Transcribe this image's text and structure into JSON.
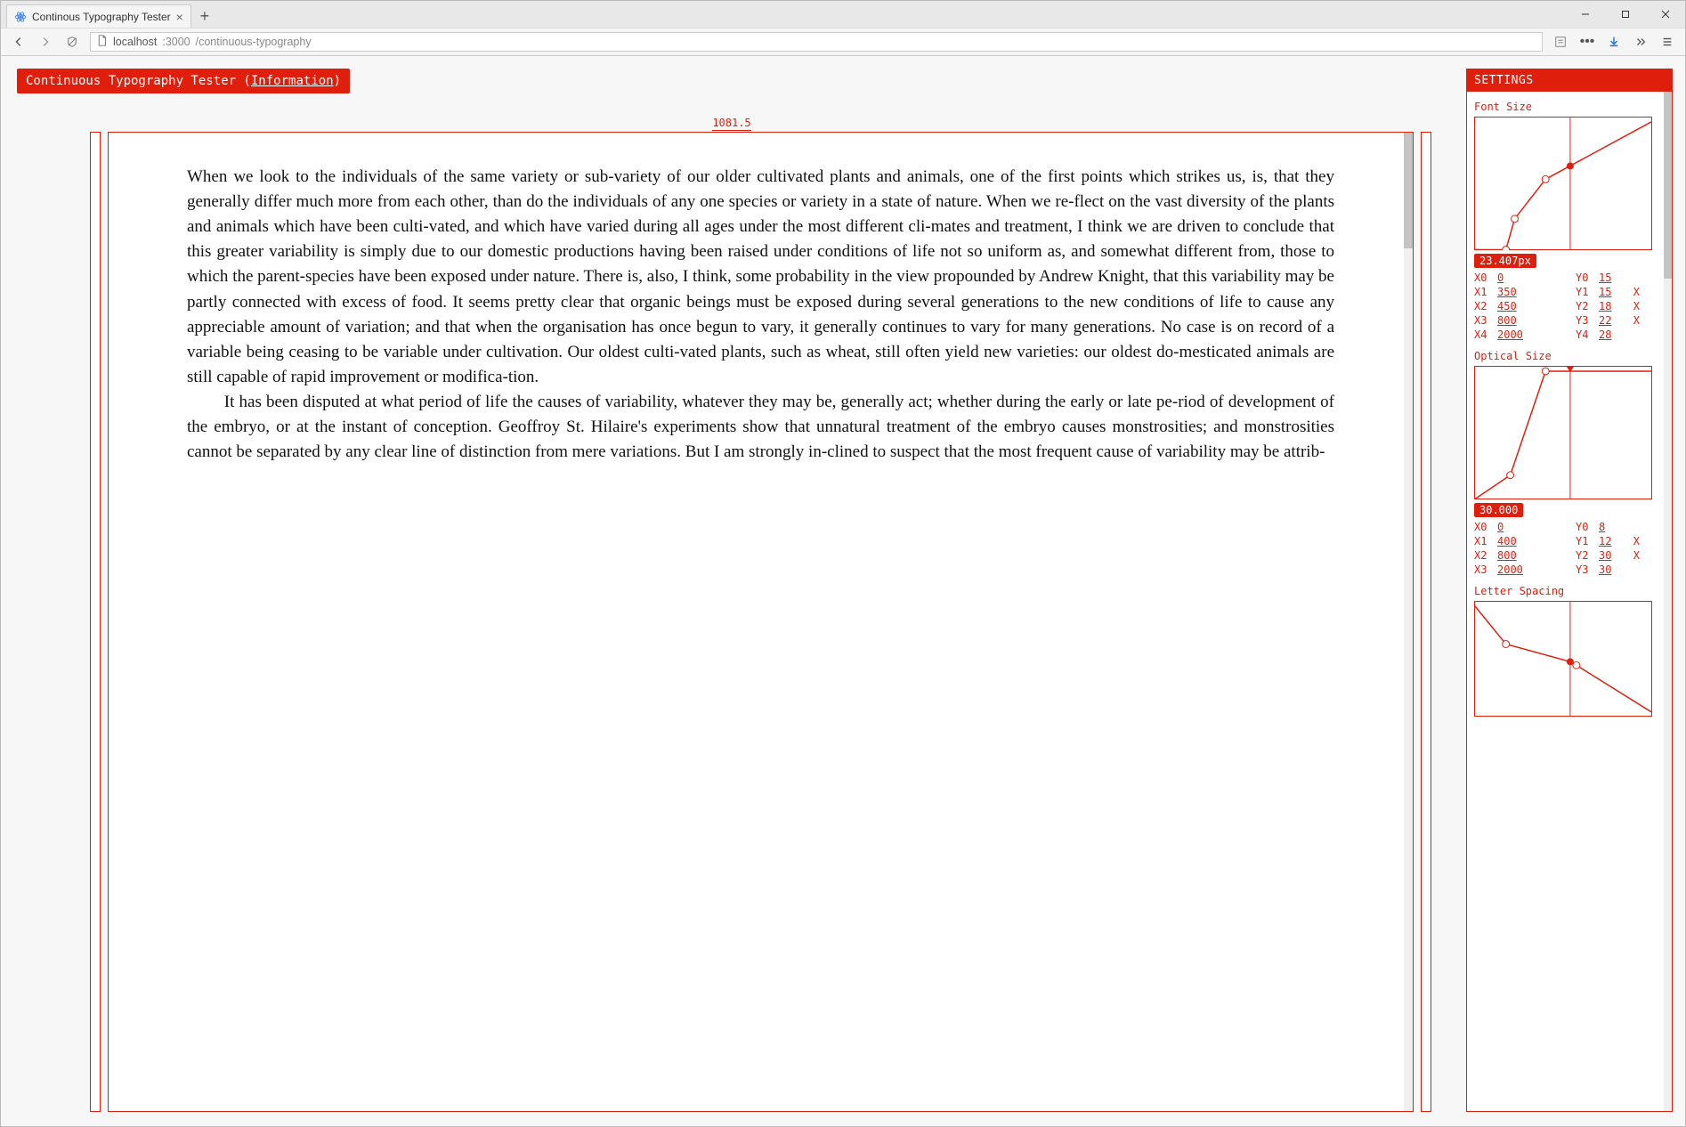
{
  "browser": {
    "tab_title": "Continous Typography Tester",
    "url_host": "localhost",
    "url_port": ":3000",
    "url_path": "/continuous-typography"
  },
  "app": {
    "title_prefix": "Continuous Typography Tester (",
    "info_link": "Information",
    "title_suffix": ")",
    "width_readout": "1081.5"
  },
  "paragraphs": {
    "p1": "When we look to the individuals of the same variety or sub-variety of our older cultivated plants and animals, one of the first points which strikes us, is, that they generally differ much more from each other, than do the individuals of any one species or variety in a state of nature. When we re‐flect on the vast diversity of the plants and animals which have been culti‐vated, and which have varied during all ages under the most different cli‐mates and treatment, I think we are driven to conclude that this greater variability is simply due to our domestic productions having been raised under conditions of life not so uniform as, and somewhat different from, those to which the parent-species have been exposed under nature. There is, also, I think, some probability in the view propounded by Andrew Knight, that this variability may be partly connected with excess of food. It seems pretty clear that organic beings must be exposed during several generations to the new conditions of life to cause any appreciable amount of variation; and that when the organisation has once begun to vary, it generally continues to vary for many generations. No case is on record of a variable being ceasing to be variable under cultivation. Our oldest culti‐vated plants, such as wheat, still often yield new varieties: our oldest do‐mesticated animals are still capable of rapid improvement or modifica‐tion.",
    "p2": "It has been disputed at what period of life the causes of variability, whatever they may be, generally act; whether during the early or late pe‐riod of development of the embryo, or at the instant of conception. Geoffroy St. Hilaire's experiments show that unnatural treatment of the embryo causes monstrosities; and monstrosities cannot be separated by any clear line of distinction from mere variations. But I am strongly in‐clined to suspect that the most frequent cause of variability may be attrib‐"
  },
  "settings": {
    "header": "SETTINGS",
    "font_size": {
      "title": "Font Size",
      "current": "23.407px",
      "rows": [
        {
          "xl": "X0",
          "xv": "0",
          "yl": "Y0",
          "yv": "15",
          "del": ""
        },
        {
          "xl": "X1",
          "xv": "350",
          "yl": "Y1",
          "yv": "15",
          "del": "X"
        },
        {
          "xl": "X2",
          "xv": "450",
          "yl": "Y2",
          "yv": "18",
          "del": "X"
        },
        {
          "xl": "X3",
          "xv": "800",
          "yl": "Y3",
          "yv": "22",
          "del": "X"
        },
        {
          "xl": "X4",
          "xv": "2000",
          "yl": "Y4",
          "yv": "28",
          "del": ""
        }
      ]
    },
    "optical_size": {
      "title": "Optical Size",
      "current": "30.000",
      "rows": [
        {
          "xl": "X0",
          "xv": "0",
          "yl": "Y0",
          "yv": "8",
          "del": ""
        },
        {
          "xl": "X1",
          "xv": "400",
          "yl": "Y1",
          "yv": "12",
          "del": "X"
        },
        {
          "xl": "X2",
          "xv": "800",
          "yl": "Y2",
          "yv": "30",
          "del": "X"
        },
        {
          "xl": "X3",
          "xv": "2000",
          "yl": "Y3",
          "yv": "30",
          "del": ""
        }
      ]
    },
    "letter_spacing": {
      "title": "Letter Spacing"
    }
  },
  "chart_data": [
    {
      "type": "line",
      "title": "Font Size",
      "xlabel": "",
      "ylabel": "",
      "xlim": [
        0,
        2000
      ],
      "ylim": [
        15,
        28
      ],
      "x": [
        0,
        350,
        450,
        800,
        2000
      ],
      "y": [
        15,
        15,
        18,
        22,
        28
      ],
      "current_x": 1081.5,
      "current_y": 23.407
    },
    {
      "type": "line",
      "title": "Optical Size",
      "xlabel": "",
      "ylabel": "",
      "xlim": [
        0,
        2000
      ],
      "ylim": [
        8,
        30
      ],
      "x": [
        0,
        400,
        800,
        2000
      ],
      "y": [
        8,
        12,
        30,
        30
      ],
      "current_x": 1081.5,
      "current_y": 30.0
    },
    {
      "type": "line",
      "title": "Letter Spacing",
      "xlabel": "",
      "ylabel": "",
      "xlim": [
        0,
        2000
      ],
      "ylim": [
        0,
        1
      ],
      "x": [
        0,
        350,
        1081.5,
        1150,
        2000
      ],
      "y": [
        1.0,
        0.62,
        0.47,
        0.44,
        0.05
      ],
      "current_x": 1081.5
    }
  ]
}
